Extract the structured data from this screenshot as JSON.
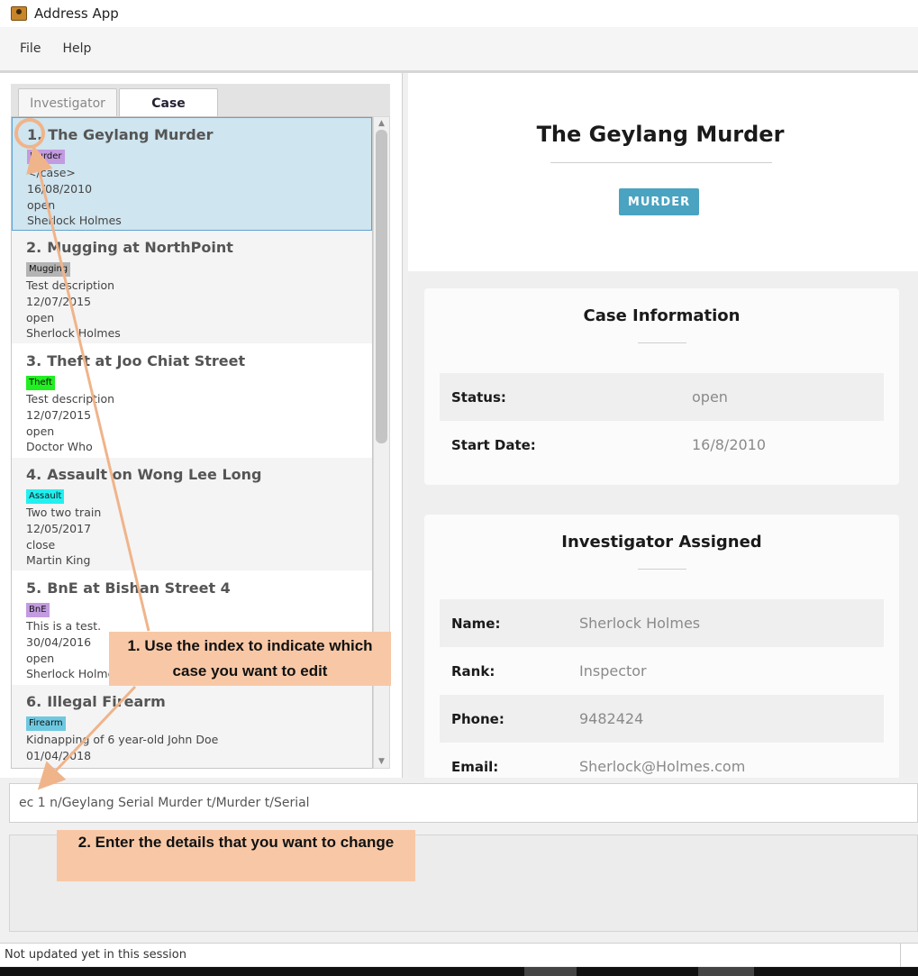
{
  "window": {
    "title": "Address App"
  },
  "menu": {
    "file": "File",
    "help": "Help"
  },
  "tabs": {
    "investigator": "Investigator",
    "case": "Case"
  },
  "cases": [
    {
      "index": "1.",
      "title": "The Geylang Murder",
      "tag": "Murder",
      "tag_color": "#c39be0",
      "description": "</case>",
      "date": "16/08/2010",
      "status": "open",
      "investigator": "Sherlock Holmes"
    },
    {
      "index": "2.",
      "title": "Mugging at NorthPoint",
      "tag": "Mugging",
      "tag_color": "#b4b4b4",
      "description": "Test description",
      "date": "12/07/2015",
      "status": "open",
      "investigator": "Sherlock Holmes"
    },
    {
      "index": "3.",
      "title": "Theft at Joo Chiat Street",
      "tag": "Theft",
      "tag_color": "#22ee22",
      "description": "Test description",
      "date": "12/07/2015",
      "status": "open",
      "investigator": "Doctor Who"
    },
    {
      "index": "4.",
      "title": "Assault on Wong Lee Long",
      "tag": "Assault",
      "tag_color": "#22f0f0",
      "description": "Two two train",
      "date": "12/05/2017",
      "status": "close",
      "investigator": "Martin King"
    },
    {
      "index": "5.",
      "title": "BnE at Bishan Street 4",
      "tag": "BnE",
      "tag_color": "#c39be0",
      "description": "This is a test.",
      "date": "30/04/2016",
      "status": "open",
      "investigator": "Sherlock Holmes"
    },
    {
      "index": "6.",
      "title": "Illegal Firearm",
      "tag": "Firearm",
      "tag_color": "#6ec9e0",
      "description": "Kidnapping of 6 year-old John Doe",
      "date": "01/04/2018",
      "status": "",
      "investigator": ""
    }
  ],
  "detail": {
    "title": "The Geylang Murder",
    "badge": "MURDER",
    "badge_color": "#4aa3c0",
    "case_info": {
      "heading": "Case Information",
      "status_label": "Status:",
      "status_value": "open",
      "start_label": "Start Date:",
      "start_value": "16/8/2010"
    },
    "investigator": {
      "heading": "Investigator Assigned",
      "name_label": "Name:",
      "name_value": "Sherlock Holmes",
      "rank_label": "Rank:",
      "rank_value": "Inspector",
      "phone_label": "Phone:",
      "phone_value": "9482424",
      "email_label": "Email:",
      "email_value": "Sherlock@Holmes.com"
    }
  },
  "command": {
    "value": "ec 1 n/Geylang Serial Murder t/Murder t/Serial"
  },
  "status_bar": {
    "text": "Not updated yet in this session"
  },
  "annotations": {
    "callout_1": "1. Use the index to indicate which case you want to edit",
    "callout_2": "2. Enter the details that you want to change",
    "arrow_color": "#f0b48a"
  }
}
